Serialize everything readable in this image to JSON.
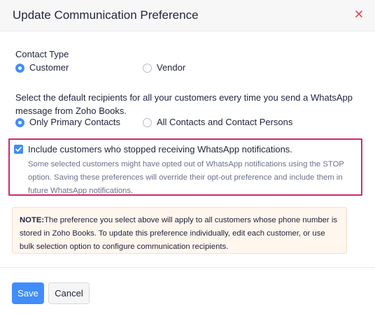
{
  "dialog": {
    "title": "Update Communication Preference",
    "close_icon": "close-icon"
  },
  "contact_type": {
    "label": "Contact Type",
    "options": [
      {
        "label": "Customer",
        "selected": true
      },
      {
        "label": "Vendor",
        "selected": false
      }
    ]
  },
  "recipients": {
    "description": "Select the default recipients for all your customers every time you send a WhatsApp message from Zoho Books.",
    "options": [
      {
        "label": "Only Primary Contacts",
        "selected": true
      },
      {
        "label": "All Contacts and Contact Persons",
        "selected": false
      }
    ]
  },
  "opt_out": {
    "checked": true,
    "label": "Include customers who stopped receiving WhatsApp notifications.",
    "hint": "Some selected customers might have opted out of WhatsApp notifications using the STOP option. Saving these preferences will override their opt-out preference and include them in future WhatsApp notifications."
  },
  "note": {
    "prefix": "NOTE:",
    "text": "The preference you select above will apply to all customers whose phone number is stored in Zoho Books. To update this preference individually, edit each customer, or use bulk selection option to configure communication recipients."
  },
  "footer": {
    "save_label": "Save",
    "cancel_label": "Cancel"
  },
  "colors": {
    "accent": "#408dfb",
    "close": "#e5484d",
    "highlight": "#d02b67",
    "note_bg": "#fff6ee"
  }
}
